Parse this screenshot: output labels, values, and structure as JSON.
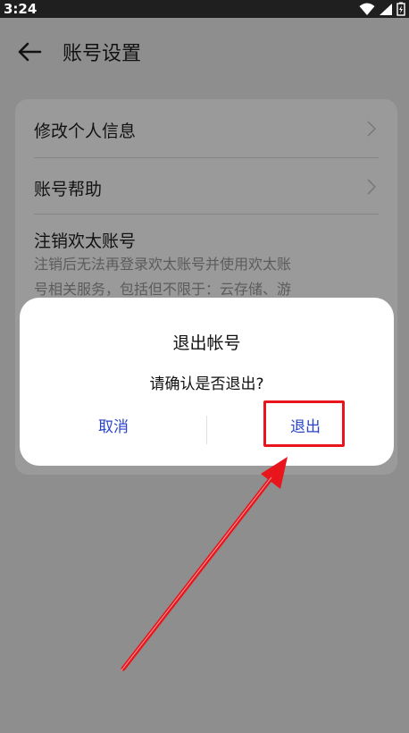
{
  "status_bar": {
    "time": "3:24"
  },
  "header": {
    "title": "账号设置"
  },
  "settings": {
    "items": [
      {
        "label": "修改个人信息"
      },
      {
        "label": "账号帮助"
      },
      {
        "label": "注销欢太账号",
        "description_line1": "注销后无法再登录欢太账号并使用欢太账",
        "description_line2": "号相关服务，包括但不限于：云存储、游"
      }
    ]
  },
  "dialog": {
    "title": "退出帐号",
    "message": "请确认是否退出?",
    "cancel_label": "取消",
    "exit_label": "退出"
  },
  "annotation": {
    "highlight_color": "#e8161c"
  },
  "colors": {
    "accent": "#2a44c9",
    "scrim": "#8e8e8e"
  }
}
